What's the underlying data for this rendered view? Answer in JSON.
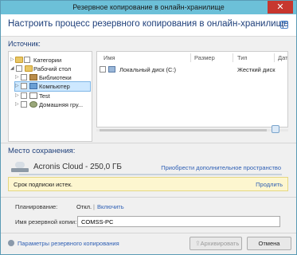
{
  "window": {
    "title": "Резервное копирование в онлайн-хранилище",
    "close_icon": "✕"
  },
  "header": {
    "title": "Настроить процесс резервного копирования в онлайн-хранилище",
    "help_icon": "?"
  },
  "source": {
    "label": "Источник:",
    "tree": [
      {
        "label": "Категории",
        "icon": "folder-icon"
      },
      {
        "label": "Рабочий стол",
        "icon": "folder-icon"
      },
      {
        "label": "Библиотеки",
        "icon": "library-icon"
      },
      {
        "label": "Компьютер",
        "icon": "computer-icon"
      },
      {
        "label": "Test",
        "icon": "document-icon"
      },
      {
        "label": "Домашняя гру...",
        "icon": "homegroup-icon"
      }
    ],
    "columns": [
      "Имя",
      "Размер",
      "Тип",
      "Дат"
    ],
    "rows": [
      {
        "name": "Локальный диск (C:)",
        "size": "",
        "type": "Жесткий диск"
      }
    ]
  },
  "destination": {
    "label": "Место сохранения:",
    "name": "Acronis Cloud - 250,0 ГБ",
    "buy_link": "Приобрести дополнительное пространство",
    "notice": "Срок подписки истек.",
    "renew_link": "Продлить"
  },
  "schedule": {
    "label": "Планирование:",
    "value": "Откл.",
    "separator": "|",
    "enable_link": "Включить"
  },
  "backup_name": {
    "label": "Имя резервной копии:",
    "value": "COMSS-PC"
  },
  "footer": {
    "params_link": "Параметры резервного копирования",
    "archive_button": "Архивировать",
    "cancel_button": "Отмена"
  },
  "colors": {
    "accent": "#6cc0d8",
    "link": "#2e5fb4",
    "heading": "#1e3f7a",
    "notice_bg": "#fdf6cf"
  }
}
